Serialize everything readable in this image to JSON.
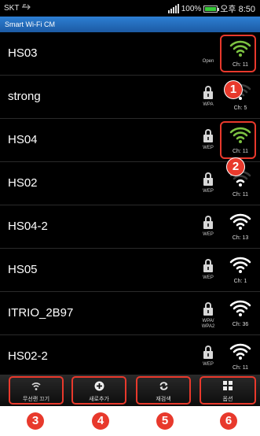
{
  "status": {
    "carrier": "SKT",
    "battery_percent": "100%",
    "time": "오후 8:50",
    "battery_level": 1.0
  },
  "app": {
    "title": "Smart Wi-Fi CM"
  },
  "networks": [
    {
      "ssid": "HS03",
      "security": "Open",
      "channel": "Ch: 11",
      "locked": false,
      "signal": 4,
      "highlight": true
    },
    {
      "ssid": "strong",
      "security": "WPA",
      "channel": "Ch: 5",
      "locked": true,
      "signal": 1,
      "highlight": false
    },
    {
      "ssid": "HS04",
      "security": "WEP",
      "channel": "Ch: 11",
      "locked": true,
      "signal": 4,
      "highlight": true
    },
    {
      "ssid": "HS02",
      "security": "WEP",
      "channel": "Ch: 11",
      "locked": true,
      "signal": 2,
      "highlight": false
    },
    {
      "ssid": "HS04-2",
      "security": "WEP",
      "channel": "Ch: 13",
      "locked": true,
      "signal": 4,
      "highlight": false
    },
    {
      "ssid": "HS05",
      "security": "WEP",
      "channel": "Ch: 1",
      "locked": true,
      "signal": 4,
      "highlight": false
    },
    {
      "ssid": "ITRIO_2B97",
      "security": "WPA/\nWPA2",
      "channel": "Ch: 36",
      "locked": true,
      "signal": 4,
      "highlight": false
    },
    {
      "ssid": "HS02-2",
      "security": "WEP",
      "channel": "Ch: 11",
      "locked": true,
      "signal": 4,
      "highlight": false
    }
  ],
  "toolbar": {
    "hide_wifi": {
      "label": "무선랜 끄기",
      "icon": "wifi-icon"
    },
    "add_new": {
      "label": "새로추가",
      "icon": "add-icon"
    },
    "rescan": {
      "label": "재검색",
      "icon": "refresh-icon"
    },
    "options": {
      "label": "옵션",
      "icon": "grid-icon"
    }
  },
  "callouts": [
    "1",
    "2",
    "3",
    "4",
    "5",
    "6"
  ],
  "colors": {
    "accent": "#e8392c",
    "wifi_active": "#7cc241",
    "wifi_default": "#ffffff",
    "title_bar": "#1c5aa3"
  }
}
